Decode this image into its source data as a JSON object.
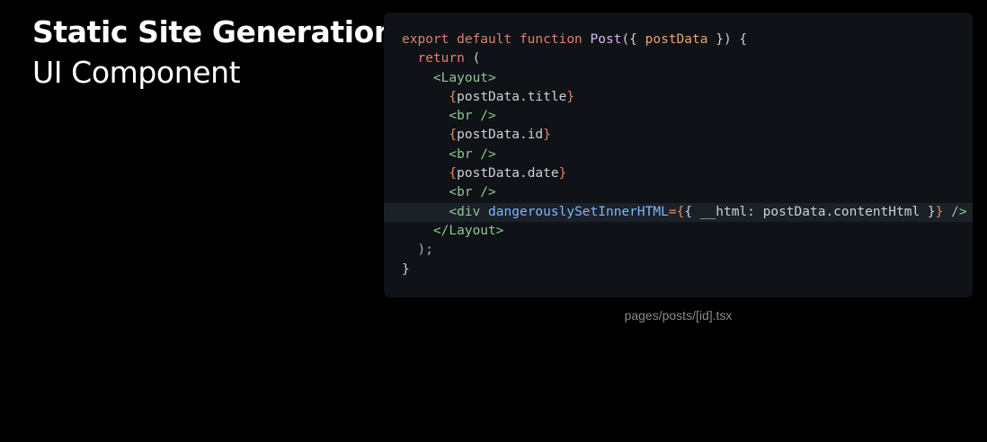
{
  "slide": {
    "title": "Static Site Generation",
    "subtitle": "UI Component"
  },
  "code": {
    "filename": "pages/posts/[id].tsx",
    "lines": [
      {
        "indent": "",
        "tokens": [
          {
            "t": "export default function ",
            "c": "kw"
          },
          {
            "t": "Post",
            "c": "fn"
          },
          {
            "t": "({ ",
            "c": "plain"
          },
          {
            "t": "postData",
            "c": "param"
          },
          {
            "t": " }) {",
            "c": "plain"
          }
        ]
      },
      {
        "indent": "  ",
        "tokens": [
          {
            "t": "return",
            "c": "kw"
          },
          {
            "t": " (",
            "c": "plain"
          }
        ]
      },
      {
        "indent": "    ",
        "tokens": [
          {
            "t": "<Layout>",
            "c": "tag"
          }
        ]
      },
      {
        "indent": "      ",
        "tokens": [
          {
            "t": "{",
            "c": "brace"
          },
          {
            "t": "postData.title",
            "c": "plain"
          },
          {
            "t": "}",
            "c": "brace"
          }
        ]
      },
      {
        "indent": "      ",
        "tokens": [
          {
            "t": "<br />",
            "c": "tag"
          }
        ]
      },
      {
        "indent": "      ",
        "tokens": [
          {
            "t": "{",
            "c": "brace"
          },
          {
            "t": "postData.id",
            "c": "plain"
          },
          {
            "t": "}",
            "c": "brace"
          }
        ]
      },
      {
        "indent": "      ",
        "tokens": [
          {
            "t": "<br />",
            "c": "tag"
          }
        ]
      },
      {
        "indent": "      ",
        "tokens": [
          {
            "t": "{",
            "c": "brace"
          },
          {
            "t": "postData.date",
            "c": "plain"
          },
          {
            "t": "}",
            "c": "brace"
          }
        ]
      },
      {
        "indent": "      ",
        "tokens": [
          {
            "t": "<br />",
            "c": "tag"
          }
        ]
      },
      {
        "indent": "      ",
        "highlight": true,
        "tokens": [
          {
            "t": "<div ",
            "c": "tag"
          },
          {
            "t": "dangerouslySetInnerHTML",
            "c": "attr"
          },
          {
            "t": "=",
            "c": "brace"
          },
          {
            "t": "{",
            "c": "brace"
          },
          {
            "t": "{ __html: postData.contentHtml }",
            "c": "plain"
          },
          {
            "t": "}",
            "c": "brace"
          },
          {
            "t": " />",
            "c": "tag"
          }
        ]
      },
      {
        "indent": "    ",
        "tokens": [
          {
            "t": "</Layout>",
            "c": "tag"
          }
        ]
      },
      {
        "indent": "  ",
        "tokens": [
          {
            "t": ");",
            "c": "punct"
          }
        ]
      },
      {
        "indent": "",
        "tokens": [
          {
            "t": "}",
            "c": "plain"
          }
        ]
      }
    ]
  },
  "colors": {
    "background": "#000000",
    "panel": "#0f1216",
    "highlight_row": "#1c2129",
    "keyword": "#e0806f",
    "tag": "#8dc891",
    "attribute": "#79b8ff",
    "param": "#f0a36b"
  }
}
